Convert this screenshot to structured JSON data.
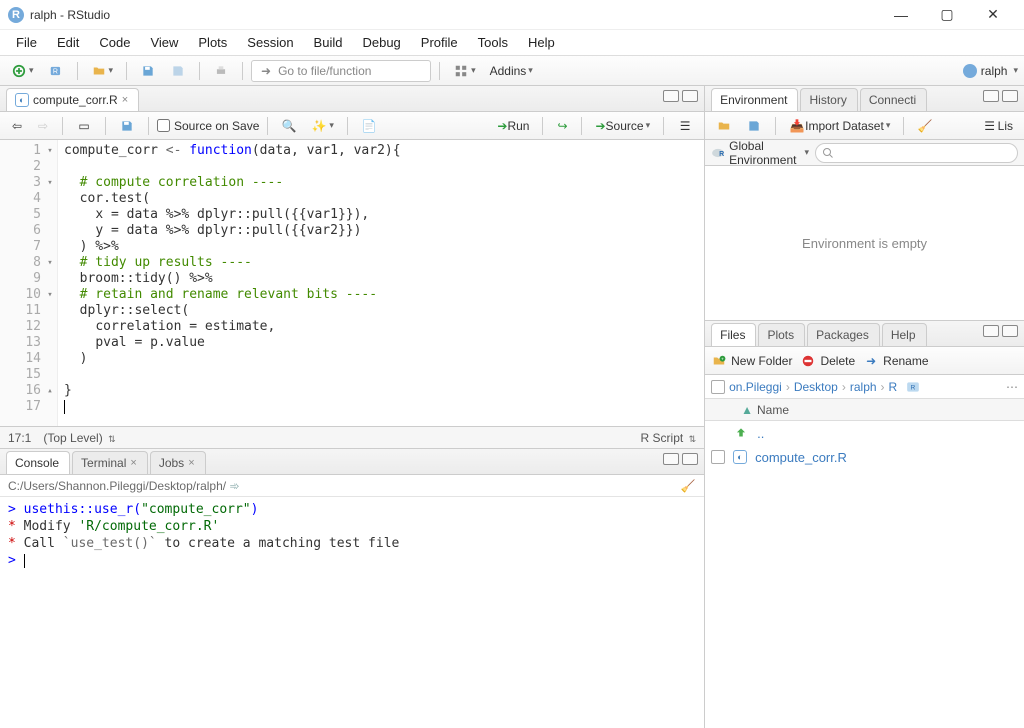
{
  "title": "ralph - RStudio",
  "menubar": [
    "File",
    "Edit",
    "Code",
    "View",
    "Plots",
    "Session",
    "Build",
    "Debug",
    "Profile",
    "Tools",
    "Help"
  ],
  "maintoolbar": {
    "goto_placeholder": "Go to file/function",
    "addins_label": "Addins",
    "user_label": "ralph"
  },
  "source": {
    "tab_label": "compute_corr.R",
    "toolbar": {
      "source_on_save": "Source on Save",
      "run": "Run",
      "source": "Source"
    },
    "code": {
      "lines": [
        {
          "n": 1,
          "fold": "▾",
          "tokens": [
            [
              "name",
              "compute_corr "
            ],
            [
              "op",
              "<- "
            ],
            [
              "kw",
              "function"
            ],
            [
              "name",
              "(data, var1, var2){"
            ]
          ]
        },
        {
          "n": 2,
          "tokens": []
        },
        {
          "n": 3,
          "fold": "▾",
          "indent": "  ",
          "tokens": [
            [
              "cm",
              "# compute correlation ----"
            ]
          ]
        },
        {
          "n": 4,
          "indent": "  ",
          "tokens": [
            [
              "name",
              "cor.test("
            ]
          ]
        },
        {
          "n": 5,
          "indent": "    ",
          "tokens": [
            [
              "name",
              "x = data %>% dplyr::pull({{var1}}),"
            ]
          ]
        },
        {
          "n": 6,
          "indent": "    ",
          "tokens": [
            [
              "name",
              "y = data %>% dplyr::pull({{var2}})"
            ]
          ]
        },
        {
          "n": 7,
          "indent": "  ",
          "tokens": [
            [
              "name",
              ") %>%"
            ]
          ]
        },
        {
          "n": 8,
          "fold": "▾",
          "indent": "  ",
          "tokens": [
            [
              "cm",
              "# tidy up results ----"
            ]
          ]
        },
        {
          "n": 9,
          "indent": "  ",
          "tokens": [
            [
              "name",
              "broom::tidy() %>%"
            ]
          ]
        },
        {
          "n": 10,
          "fold": "▾",
          "indent": "  ",
          "tokens": [
            [
              "cm",
              "# retain and rename relevant bits ----"
            ]
          ]
        },
        {
          "n": 11,
          "indent": "  ",
          "tokens": [
            [
              "name",
              "dplyr::select("
            ]
          ]
        },
        {
          "n": 12,
          "indent": "    ",
          "tokens": [
            [
              "name",
              "correlation = estimate,"
            ]
          ]
        },
        {
          "n": 13,
          "indent": "    ",
          "tokens": [
            [
              "name",
              "pval = p.value"
            ]
          ]
        },
        {
          "n": 14,
          "indent": "  ",
          "tokens": [
            [
              "name",
              ")"
            ]
          ]
        },
        {
          "n": 15,
          "tokens": []
        },
        {
          "n": 16,
          "fold": "▴",
          "tokens": [
            [
              "name",
              "}"
            ]
          ]
        },
        {
          "n": 17,
          "tokens": []
        }
      ]
    },
    "status": {
      "pos": "17:1",
      "scope": "(Top Level)",
      "type": "R Script"
    }
  },
  "console": {
    "tabs": [
      "Console",
      "Terminal",
      "Jobs"
    ],
    "path": "C:/Users/Shannon.Pileggi/Desktop/ralph/",
    "lines": [
      {
        "prompt": ">",
        "parts": [
          [
            "input",
            " usethis::use_r("
          ],
          [
            "quote",
            "\"compute_corr\""
          ],
          [
            "input",
            ")"
          ]
        ]
      },
      {
        "prompt": "*",
        "parts": [
          [
            "plain",
            " Modify "
          ],
          [
            "quote",
            "'R/compute_corr.R'"
          ]
        ]
      },
      {
        "prompt": "*",
        "parts": [
          [
            "plain",
            " Call "
          ],
          [
            "code",
            "`use_test()`"
          ],
          [
            "plain",
            " to create a matching test file"
          ]
        ]
      },
      {
        "prompt": ">",
        "parts": [
          [
            "cursor",
            ""
          ]
        ]
      }
    ]
  },
  "environment": {
    "tabs": [
      "Environment",
      "History",
      "Connecti"
    ],
    "import_label": "Import Dataset",
    "list_label": "Lis",
    "scope_label": "Global Environment",
    "empty_text": "Environment is empty"
  },
  "files": {
    "tabs": [
      "Files",
      "Plots",
      "Packages",
      "Help"
    ],
    "toolbar": {
      "new_folder": "New Folder",
      "delete": "Delete",
      "rename": "Rename"
    },
    "breadcrumb": [
      "on.Pileggi",
      "Desktop",
      "ralph",
      "R"
    ],
    "header": "Name",
    "rows": [
      {
        "name": "..",
        "type": "up"
      },
      {
        "name": "compute_corr.R",
        "type": "r"
      }
    ]
  }
}
